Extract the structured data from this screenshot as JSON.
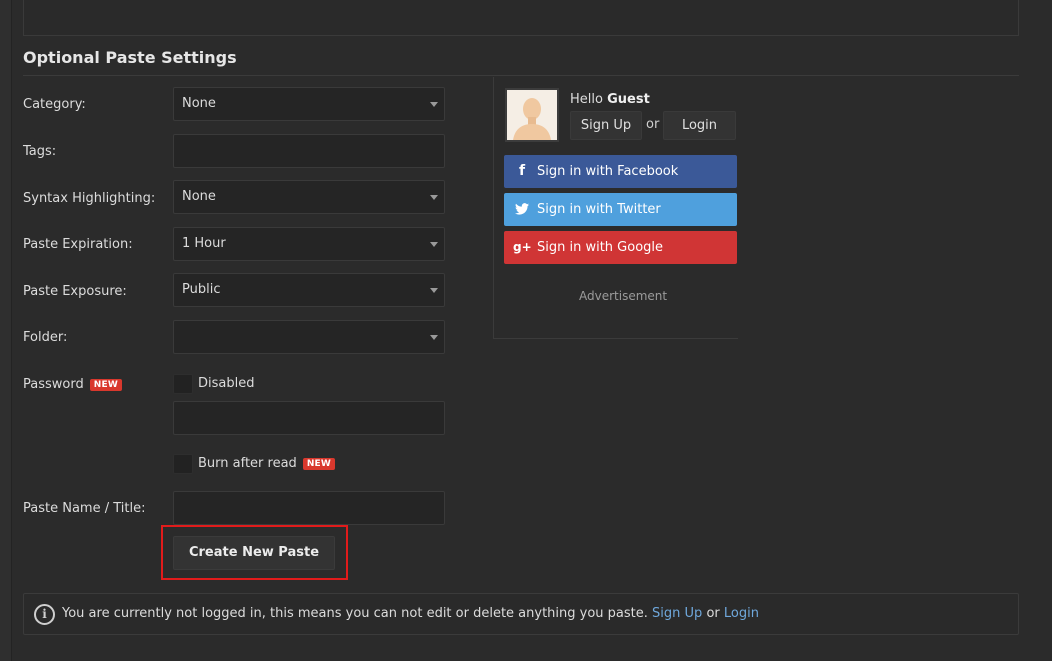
{
  "section": {
    "title": "Optional Paste Settings"
  },
  "form": {
    "category": {
      "label": "Category:",
      "value": "None"
    },
    "tags": {
      "label": "Tags:",
      "value": ""
    },
    "syntax": {
      "label": "Syntax Highlighting:",
      "value": "None"
    },
    "expiration": {
      "label": "Paste Expiration:",
      "value": "1 Hour"
    },
    "exposure": {
      "label": "Paste Exposure:",
      "value": "Public"
    },
    "folder": {
      "label": "Folder:",
      "value": ""
    },
    "password": {
      "label": "Password",
      "badge": "NEW",
      "checkbox_label": "Disabled",
      "value": ""
    },
    "burn": {
      "label": "Burn after read",
      "badge": "NEW"
    },
    "title": {
      "label": "Paste Name / Title:",
      "value": ""
    },
    "submit_label": "Create New Paste"
  },
  "sidebar": {
    "greeting": "Hello",
    "user": "Guest",
    "signup_label": "Sign Up",
    "or_text": "or",
    "login_label": "Login",
    "social": [
      {
        "label": "Sign in with Facebook",
        "icon": "facebook-icon",
        "color": "#3b5998"
      },
      {
        "label": "Sign in with Twitter",
        "icon": "twitter-icon",
        "color": "#4fa0dd"
      },
      {
        "label": "Sign in with Google",
        "icon": "google-plus-icon",
        "color": "#d03535"
      }
    ],
    "advertisement": "Advertisement"
  },
  "notice": {
    "text": "You are currently not logged in, this means you can not edit or delete anything you paste.",
    "signup_link": "Sign Up",
    "or_text": "or",
    "login_link": "Login"
  },
  "colors": {
    "background": "#2b2b2b",
    "highlight": "#e11b1b",
    "badge": "#d9382d",
    "link": "#6fa8dc"
  }
}
